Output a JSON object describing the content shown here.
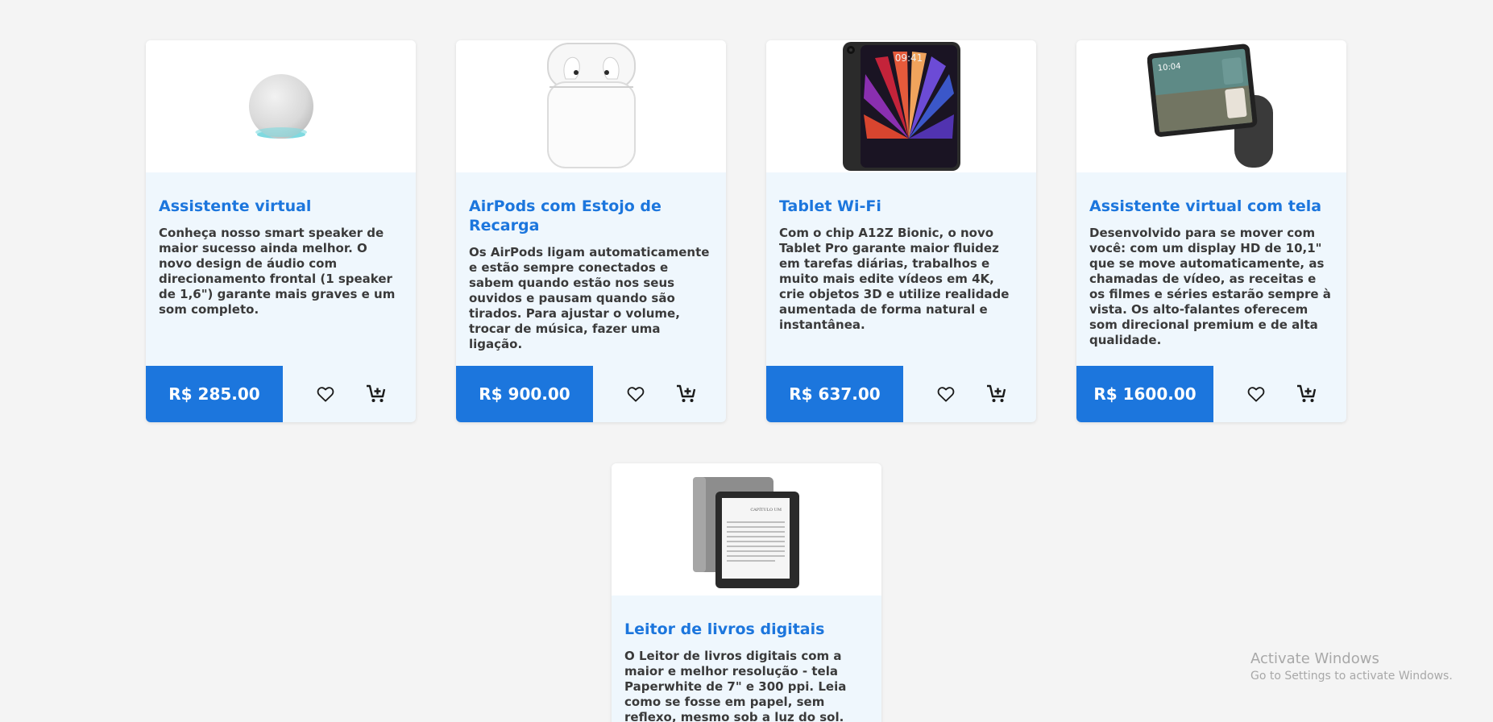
{
  "products": [
    {
      "title": "Assistente virtual",
      "description": "Conheça nosso smart speaker de maior sucesso ainda melhor. O novo design de áudio com direcionamento frontal (1 speaker de 1,6\") garante mais graves e um som completo.",
      "price": "R$ 285.00",
      "image": "smart-speaker-sphere"
    },
    {
      "title": "AirPods com Estojo de Recarga",
      "description": "Os AirPods ligam automaticamente e estão sempre conectados e sabem quando estão nos seus ouvidos e pausam quando são tirados. Para ajustar o volume, trocar de música, fazer uma ligação.",
      "price": "R$ 900.00",
      "image": "airpods-case"
    },
    {
      "title": "Tablet Wi-Fi",
      "description": "Com o chip A12Z Bionic, o novo Tablet Pro garante maior fluidez em tarefas diárias, trabalhos e muito mais edite vídeos em 4K, crie objetos 3D e utilize realidade aumentada de forma natural e instantânea.",
      "price": "R$ 637.00",
      "image": "tablet",
      "image_text": "09:41"
    },
    {
      "title": "Assistente virtual com tela",
      "description": "Desenvolvido para se mover com você: com um display HD de 10,1\" que se move automaticamente, as chamadas de vídeo, as receitas e os filmes e séries estarão sempre à vista. Os alto-falantes oferecem som direcional premium e de alta qualidade.",
      "price": "R$ 1600.00",
      "image": "smart-display",
      "image_text": "10:04"
    },
    {
      "title": "Leitor de livros digitais",
      "description": "O Leitor de livros digitais com a maior e melhor resolução - tela Paperwhite de 7\" e 300 ppi. Leia como se fosse em papel, sem reflexo, mesmo sob a luz do sol.",
      "price": "",
      "image": "ereader",
      "image_text": "CAPÍTULO UM"
    }
  ],
  "icons": {
    "favorite": "heart-outline-icon",
    "cart": "cart-add-icon"
  },
  "colors": {
    "accent": "#1c76dd",
    "card_bg": "#eff7fd",
    "page_bg": "#f4f4f4"
  },
  "watermark": {
    "line1": "Activate Windows",
    "line2": "Go to Settings to activate Windows."
  }
}
